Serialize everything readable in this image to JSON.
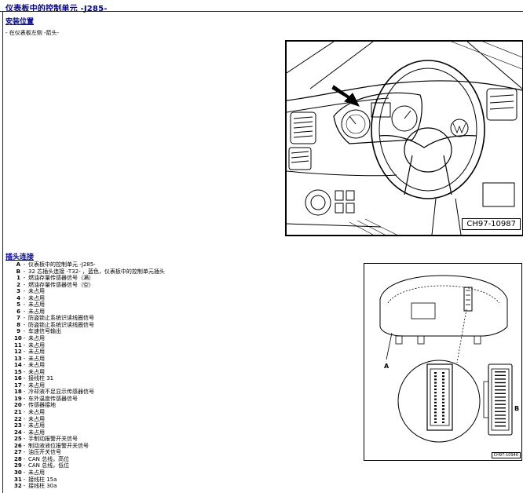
{
  "title": "仪表板中的控制单元 -J285-",
  "install": {
    "heading": "安装位置",
    "location": "- 在仪表板左侧 -箭头-",
    "figure_code": "CH97-10987"
  },
  "connector": {
    "heading": "插头连接",
    "figure_code": "CH97-10946",
    "label_a": "A",
    "label_b": "B",
    "items": [
      {
        "num": "A",
        "text": "仪表板中的控制单元 -J285-"
      },
      {
        "num": "B",
        "text": "32 芯插头连接 -T32- ，蓝色，仪表板中的控制单元插头"
      },
      {
        "num": "1",
        "text": "燃油存量传感器信号（满）"
      },
      {
        "num": "2",
        "text": "燃油存量传感器信号（空）"
      },
      {
        "num": "3",
        "text": "未占用"
      },
      {
        "num": "4",
        "text": "未占用"
      },
      {
        "num": "5",
        "text": "未占用"
      },
      {
        "num": "6",
        "text": "未占用"
      },
      {
        "num": "7",
        "text": "防盗锁止系统识读线圈信号"
      },
      {
        "num": "8",
        "text": "防盗锁止系统识读线圈信号"
      },
      {
        "num": "9",
        "text": "车速信号输出"
      },
      {
        "num": "10",
        "text": "未占用"
      },
      {
        "num": "11",
        "text": "未占用"
      },
      {
        "num": "12",
        "text": "未占用"
      },
      {
        "num": "13",
        "text": "未占用"
      },
      {
        "num": "14",
        "text": "未占用"
      },
      {
        "num": "15",
        "text": "未占用"
      },
      {
        "num": "16",
        "text": "接线柱 31"
      },
      {
        "num": "17",
        "text": "未占用"
      },
      {
        "num": "18",
        "text": "冷却液不足显示传感器信号"
      },
      {
        "num": "19",
        "text": "车外温度传感器信号"
      },
      {
        "num": "20",
        "text": "传感器接地"
      },
      {
        "num": "21",
        "text": "未占用"
      },
      {
        "num": "22",
        "text": "未占用"
      },
      {
        "num": "23",
        "text": "未占用"
      },
      {
        "num": "24",
        "text": "未占用"
      },
      {
        "num": "25",
        "text": "手制动报警开关信号"
      },
      {
        "num": "26",
        "text": "制动液液位报警开关信号"
      },
      {
        "num": "27",
        "text": "油压开关信号"
      },
      {
        "num": "28",
        "text": "CAN 总线，高位"
      },
      {
        "num": "29",
        "text": "CAN 总线，低位"
      },
      {
        "num": "30",
        "text": "未占用"
      },
      {
        "num": "31",
        "text": "接线柱 15a"
      },
      {
        "num": "32",
        "text": "接线柱 30a"
      }
    ]
  }
}
